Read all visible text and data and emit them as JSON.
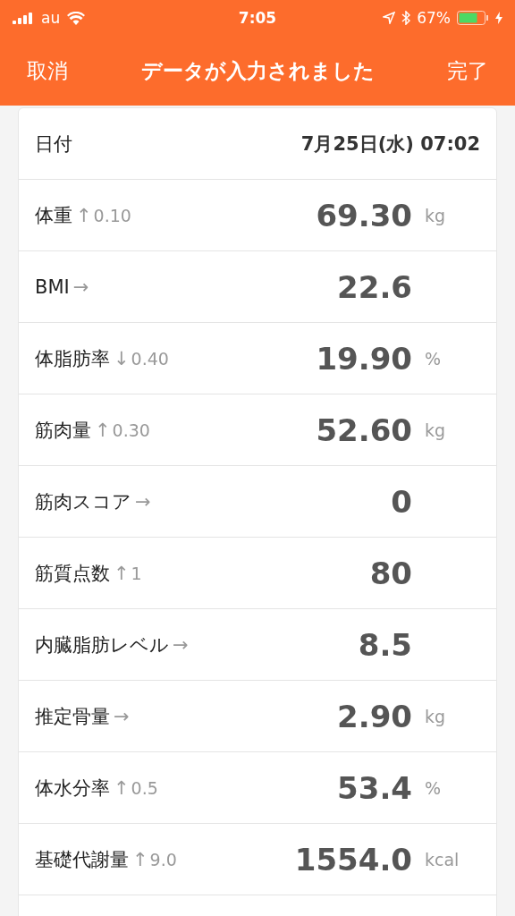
{
  "status_bar": {
    "carrier": "au",
    "time": "7:05",
    "battery": "67%"
  },
  "nav": {
    "cancel": "取消",
    "title": "データが入力されました",
    "done": "完了"
  },
  "date_row": {
    "label": "日付",
    "value": "7月25日(水) 07:02"
  },
  "rows": [
    {
      "label": "体重",
      "trend": "↑",
      "delta": "0.10",
      "value": "69.30",
      "unit": "kg"
    },
    {
      "label": "BMI",
      "trend": "→",
      "value": "22.6"
    },
    {
      "label": "体脂肪率",
      "trend": "↓",
      "delta": "0.40",
      "value": "19.90",
      "unit": "%"
    },
    {
      "label": "筋肉量",
      "trend": "↑",
      "delta": "0.30",
      "value": "52.60",
      "unit": "kg"
    },
    {
      "label": "筋肉スコア",
      "trend": "→",
      "value": "0"
    },
    {
      "label": "筋質点数",
      "trend": "↑",
      "delta": "1",
      "value": "80"
    },
    {
      "label": "内臓脂肪レベル",
      "trend": "→",
      "value": "8.5"
    },
    {
      "label": "推定骨量",
      "trend": "→",
      "value": "2.90",
      "unit": "kg"
    },
    {
      "label": "体水分率",
      "trend": "↑",
      "delta": "0.5",
      "value": "53.4",
      "unit": "%"
    },
    {
      "label": "基礎代謝量",
      "trend": "↑",
      "delta": "9.0",
      "value": "1554.0",
      "unit": "kcal"
    }
  ]
}
